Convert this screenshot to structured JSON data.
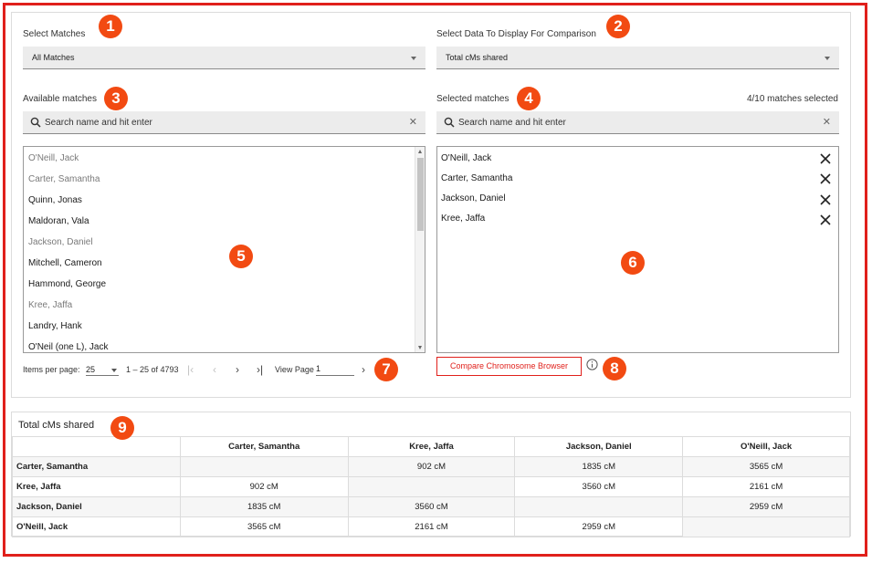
{
  "select_matches": {
    "label": "Select Matches",
    "value": "All Matches"
  },
  "select_data": {
    "label": "Select Data To Display For Comparison",
    "value": "Total cMs shared"
  },
  "available": {
    "label": "Available matches",
    "search_placeholder": "Search name and hit enter",
    "items": [
      {
        "name": "O'Neill, Jack",
        "selected": true
      },
      {
        "name": "Carter, Samantha",
        "selected": true
      },
      {
        "name": "Quinn, Jonas",
        "selected": false
      },
      {
        "name": "Maldoran, Vala",
        "selected": false
      },
      {
        "name": "Jackson, Daniel",
        "selected": true
      },
      {
        "name": "Mitchell, Cameron",
        "selected": false
      },
      {
        "name": "Hammond, George",
        "selected": false
      },
      {
        "name": "Kree, Jaffa",
        "selected": true
      },
      {
        "name": "Landry, Hank",
        "selected": false
      },
      {
        "name": "O'Neil (one L), Jack",
        "selected": false
      }
    ]
  },
  "selected": {
    "label": "Selected matches",
    "count_text": "4/10 matches selected",
    "search_placeholder": "Search name and hit enter",
    "items": [
      "O'Neill, Jack",
      "Carter, Samantha",
      "Jackson, Daniel",
      "Kree, Jaffa"
    ]
  },
  "pager": {
    "items_per_page_label": "Items per page:",
    "items_per_page": "25",
    "range": "1 – 25 of 4793",
    "view_page_label": "View Page",
    "page": "1"
  },
  "compare_button": "Compare Chromosome Browser",
  "badges": [
    "1",
    "2",
    "3",
    "4",
    "5",
    "6",
    "7",
    "8",
    "9"
  ],
  "accent_color": "#e0201b",
  "badge_color": "#f24a12",
  "table": {
    "title": "Total cMs shared",
    "columns": [
      "Carter, Samantha",
      "Kree, Jaffa",
      "Jackson, Daniel",
      "O'Neill, Jack"
    ],
    "rows": [
      {
        "name": "Carter, Samantha",
        "cells": [
          "",
          "902 cM",
          "1835 cM",
          "3565 cM"
        ]
      },
      {
        "name": "Kree, Jaffa",
        "cells": [
          "902 cM",
          "",
          "3560 cM",
          "2161 cM"
        ]
      },
      {
        "name": "Jackson, Daniel",
        "cells": [
          "1835 cM",
          "3560 cM",
          "",
          "2959 cM"
        ]
      },
      {
        "name": "O'Neill, Jack",
        "cells": [
          "3565 cM",
          "2161 cM",
          "2959 cM",
          ""
        ]
      }
    ]
  }
}
